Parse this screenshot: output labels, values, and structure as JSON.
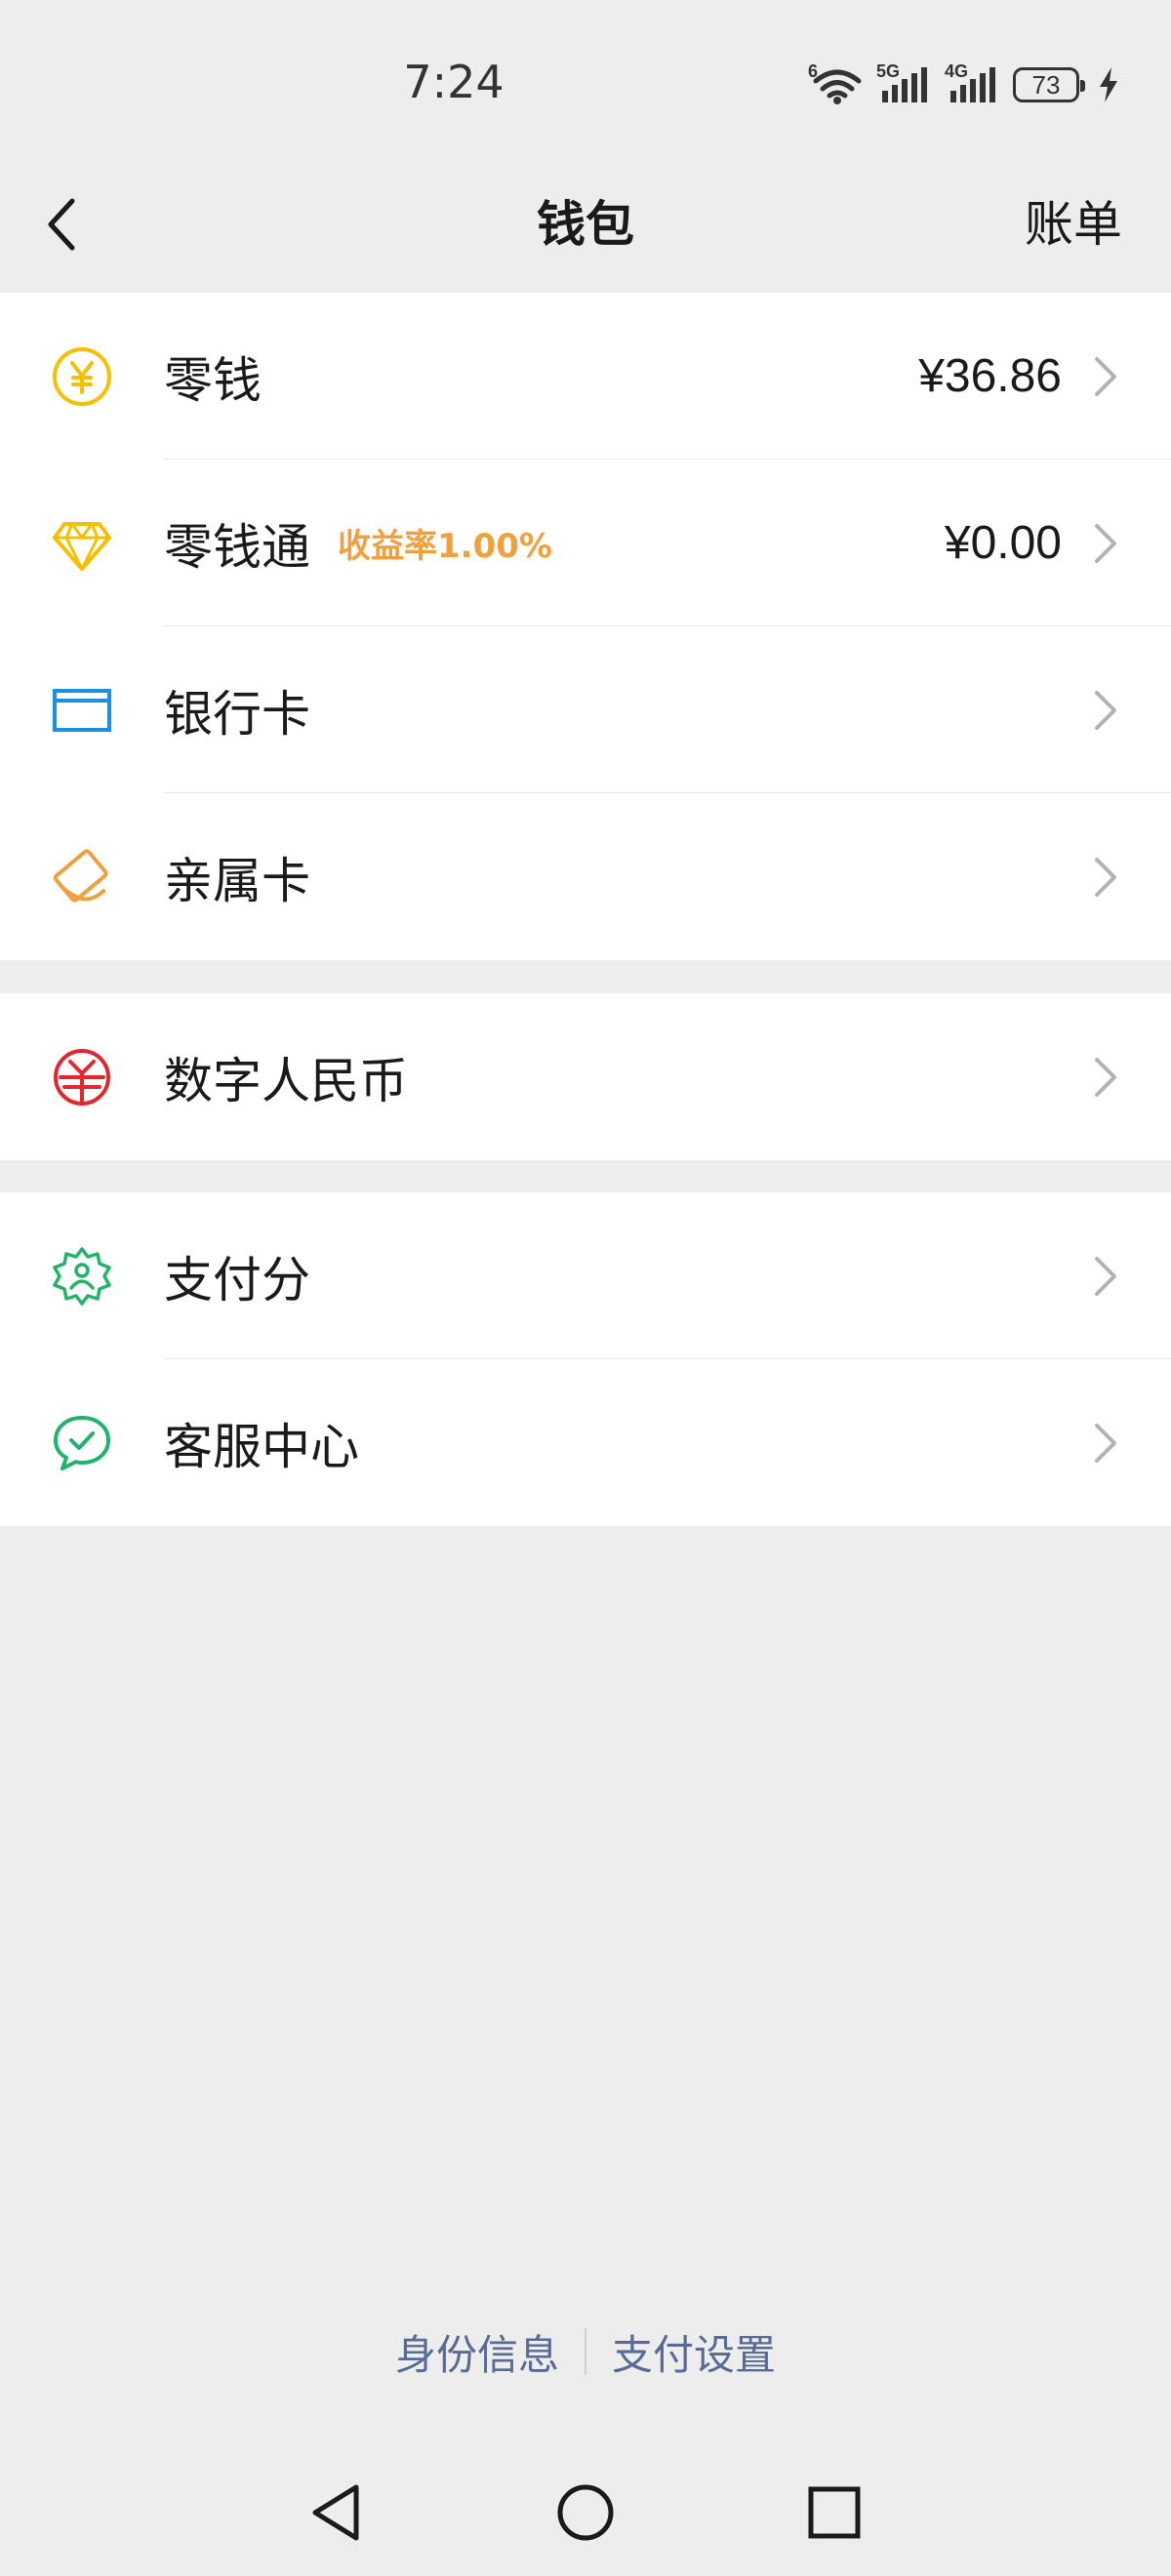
{
  "status_bar": {
    "time": "7:24",
    "wifi_label": "6",
    "signal1_label": "5G",
    "signal2_label": "4G",
    "battery_level": "73"
  },
  "nav": {
    "title": "钱包",
    "right_action": "账单"
  },
  "section1": [
    {
      "label": "零钱",
      "value": "¥36.86",
      "icon": "yuan-coin-icon",
      "color": "#f6c000"
    },
    {
      "label": "零钱通",
      "badge": "收益率1.00%",
      "value": "¥0.00",
      "icon": "diamond-icon",
      "color": "#f6c000"
    },
    {
      "label": "银行卡",
      "icon": "bank-card-icon",
      "color": "#1a8fe6"
    },
    {
      "label": "亲属卡",
      "icon": "family-card-icon",
      "color": "#f0a03c"
    }
  ],
  "section2": [
    {
      "label": "数字人民币",
      "icon": "digital-rmb-icon",
      "color": "#e3262e"
    }
  ],
  "section3": [
    {
      "label": "支付分",
      "icon": "pay-score-icon",
      "color": "#1fb46a"
    },
    {
      "label": "客服中心",
      "icon": "customer-service-icon",
      "color": "#1fb46a"
    }
  ],
  "footer": {
    "identity_link": "身份信息",
    "settings_link": "支付设置"
  },
  "colors": {
    "background": "#ededed",
    "link": "#576b95",
    "badge": "#f0a03c"
  }
}
